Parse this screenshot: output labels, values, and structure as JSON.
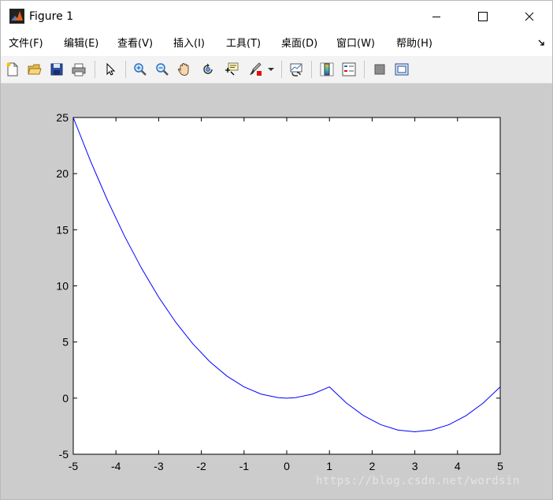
{
  "window": {
    "title": "Figure 1",
    "icon": "matlab-logo-icon",
    "controls": [
      "minimize-icon",
      "maximize-icon",
      "close-icon"
    ]
  },
  "menu": {
    "items": [
      {
        "label": "文件(F)"
      },
      {
        "label": "编辑(E)"
      },
      {
        "label": "查看(V)"
      },
      {
        "label": "插入(I)"
      },
      {
        "label": "工具(T)"
      },
      {
        "label": "桌面(D)"
      },
      {
        "label": "窗口(W)"
      },
      {
        "label": "帮助(H)"
      }
    ]
  },
  "toolbar": {
    "icons": [
      "new-figure-icon",
      "open-file-icon",
      "save-icon",
      "print-icon",
      "select-arrow-icon",
      "zoom-in-icon",
      "zoom-out-icon",
      "pan-hand-icon",
      "rotate-3d-icon",
      "data-cursor-icon",
      "brush-icon",
      "link-plot-icon",
      "colorbar-icon",
      "legend-icon",
      "hide-plot-tools-icon",
      "show-plot-tools-icon"
    ]
  },
  "colors": {
    "figure_background": "#cccccc",
    "axes_background": "#ffffff",
    "line": "#0000ff"
  },
  "watermark": "https://blog.csdn.net/wordsin",
  "chart_data": {
    "type": "line",
    "title": "",
    "xlabel": "",
    "ylabel": "",
    "xlim": [
      -5,
      5
    ],
    "ylim": [
      -5,
      25
    ],
    "xticks": [
      -5,
      -4,
      -3,
      -2,
      -1,
      0,
      1,
      2,
      3,
      4,
      5
    ],
    "yticks": [
      -5,
      0,
      5,
      10,
      15,
      20,
      25
    ],
    "grid": false,
    "series": [
      {
        "color": "#0000ff",
        "x": [
          -5,
          -4.6,
          -4.2,
          -3.8,
          -3.4,
          -3.0,
          -2.6,
          -2.2,
          -1.8,
          -1.4,
          -1.0,
          -0.6,
          -0.2,
          0,
          0.2,
          0.6,
          1.0,
          1.4,
          1.8,
          2.2,
          2.6,
          3.0,
          3.4,
          3.8,
          4.2,
          4.6,
          5.0
        ],
        "y": [
          25,
          21.16,
          17.64,
          14.44,
          11.56,
          9.0,
          6.76,
          4.84,
          3.24,
          1.96,
          1.0,
          0.36,
          0.04,
          0,
          0.04,
          0.36,
          1.0,
          -0.44,
          -1.56,
          -2.36,
          -2.84,
          -3.0,
          -2.84,
          -2.36,
          -1.56,
          -0.44,
          1.0
        ]
      }
    ]
  }
}
